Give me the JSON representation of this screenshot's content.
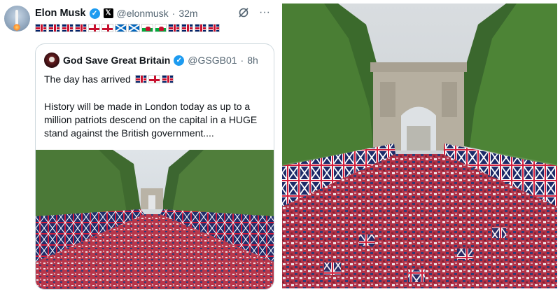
{
  "tweet": {
    "author_name": "Elon Musk",
    "author_handle": "@elonmusk",
    "separator": "·",
    "time": "32m",
    "flags": [
      "uk",
      "uk",
      "uk",
      "uk",
      "eng",
      "eng",
      "sco",
      "sco",
      "wal",
      "wal",
      "uk",
      "uk",
      "uk",
      "uk"
    ],
    "more_glyph": "···",
    "quoted": {
      "author_name": "God Save Great Britain",
      "author_handle": "@GSGB01",
      "time": "8h",
      "line1": "The day has arrived",
      "line1_flags": [
        "uk",
        "eng",
        "uk"
      ],
      "body": "History will be made in London today as up to a million patriots descend on the capital in a HUGE stand against the British government...."
    }
  },
  "colors": {
    "verified_blue": "#1d9bf0",
    "secondary_text": "#536471",
    "border": "#cfd9de"
  },
  "icons": [
    "verified-badge-icon",
    "x-logo-icon",
    "grok-icon",
    "more-icon"
  ]
}
